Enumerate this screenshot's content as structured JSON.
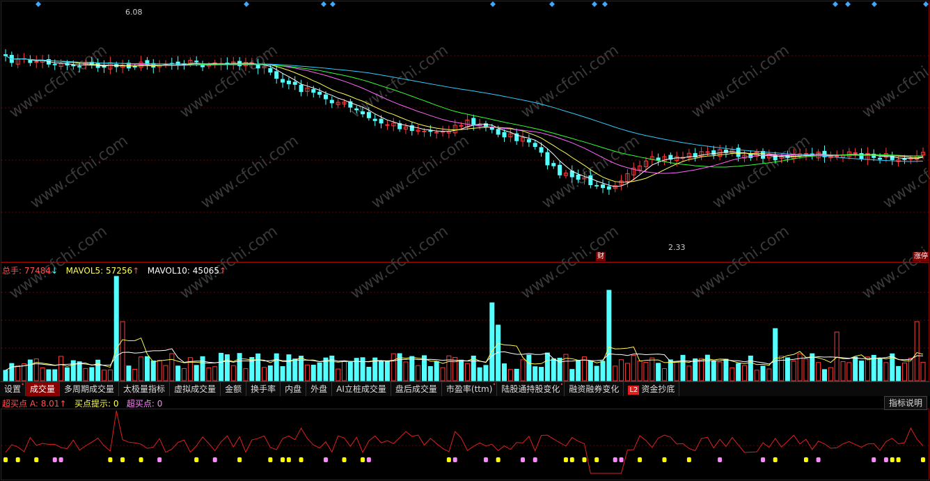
{
  "price_panel": {
    "high_label": "6.08",
    "low_label": "2.33",
    "badge_cai": "财",
    "badge_ban": "涨停"
  },
  "volume_panel": {
    "total_label": "总手:",
    "total_value": "77484",
    "total_arrow": "↓",
    "mavol5_label": "MAVOL5:",
    "mavol5_value": "57256",
    "mavol5_arrow": "↑",
    "mavol10_label": "MAVOL10:",
    "mavol10_value": "45065",
    "mavol10_arrow": "↑"
  },
  "tabs": [
    {
      "label": "设置",
      "dot": true
    },
    {
      "label": "成交量",
      "active": true
    },
    {
      "label": "多周期成交量"
    },
    {
      "label": "太极量指标"
    },
    {
      "label": "虚拟成交量"
    },
    {
      "label": "金额"
    },
    {
      "label": "换手率"
    },
    {
      "label": "内盘"
    },
    {
      "label": "外盘"
    },
    {
      "label": "AI立桩成交量"
    },
    {
      "label": "盘后成交量"
    },
    {
      "label": "市盈率(ttm)",
      "dot": true
    },
    {
      "label": "陆股通持股变化",
      "dot": true
    },
    {
      "label": "融资融券变化"
    },
    {
      "label": "资金抄底",
      "l2": "L2"
    }
  ],
  "indicator_panel": {
    "name": "超买点",
    "a_label": "A:",
    "a_value": "8.01",
    "a_arrow": "↑",
    "buy_hint_label": "买点提示:",
    "buy_hint_value": "0",
    "overbuy_label": "超买点:",
    "overbuy_value": "0",
    "help_button": "指标说明"
  },
  "watermark": "www.cfchi.com",
  "colors": {
    "up": "#ff3b3b",
    "down": "#54ffff",
    "ma5": "#ffffff",
    "ma10": "#ffff55",
    "ma20": "#ff66ff",
    "ma30": "#33ff33",
    "ma60": "#33ccff",
    "indicator_line": "#e02020",
    "marker_yellow": "#ffff00",
    "marker_pink": "#ff88ff"
  }
}
